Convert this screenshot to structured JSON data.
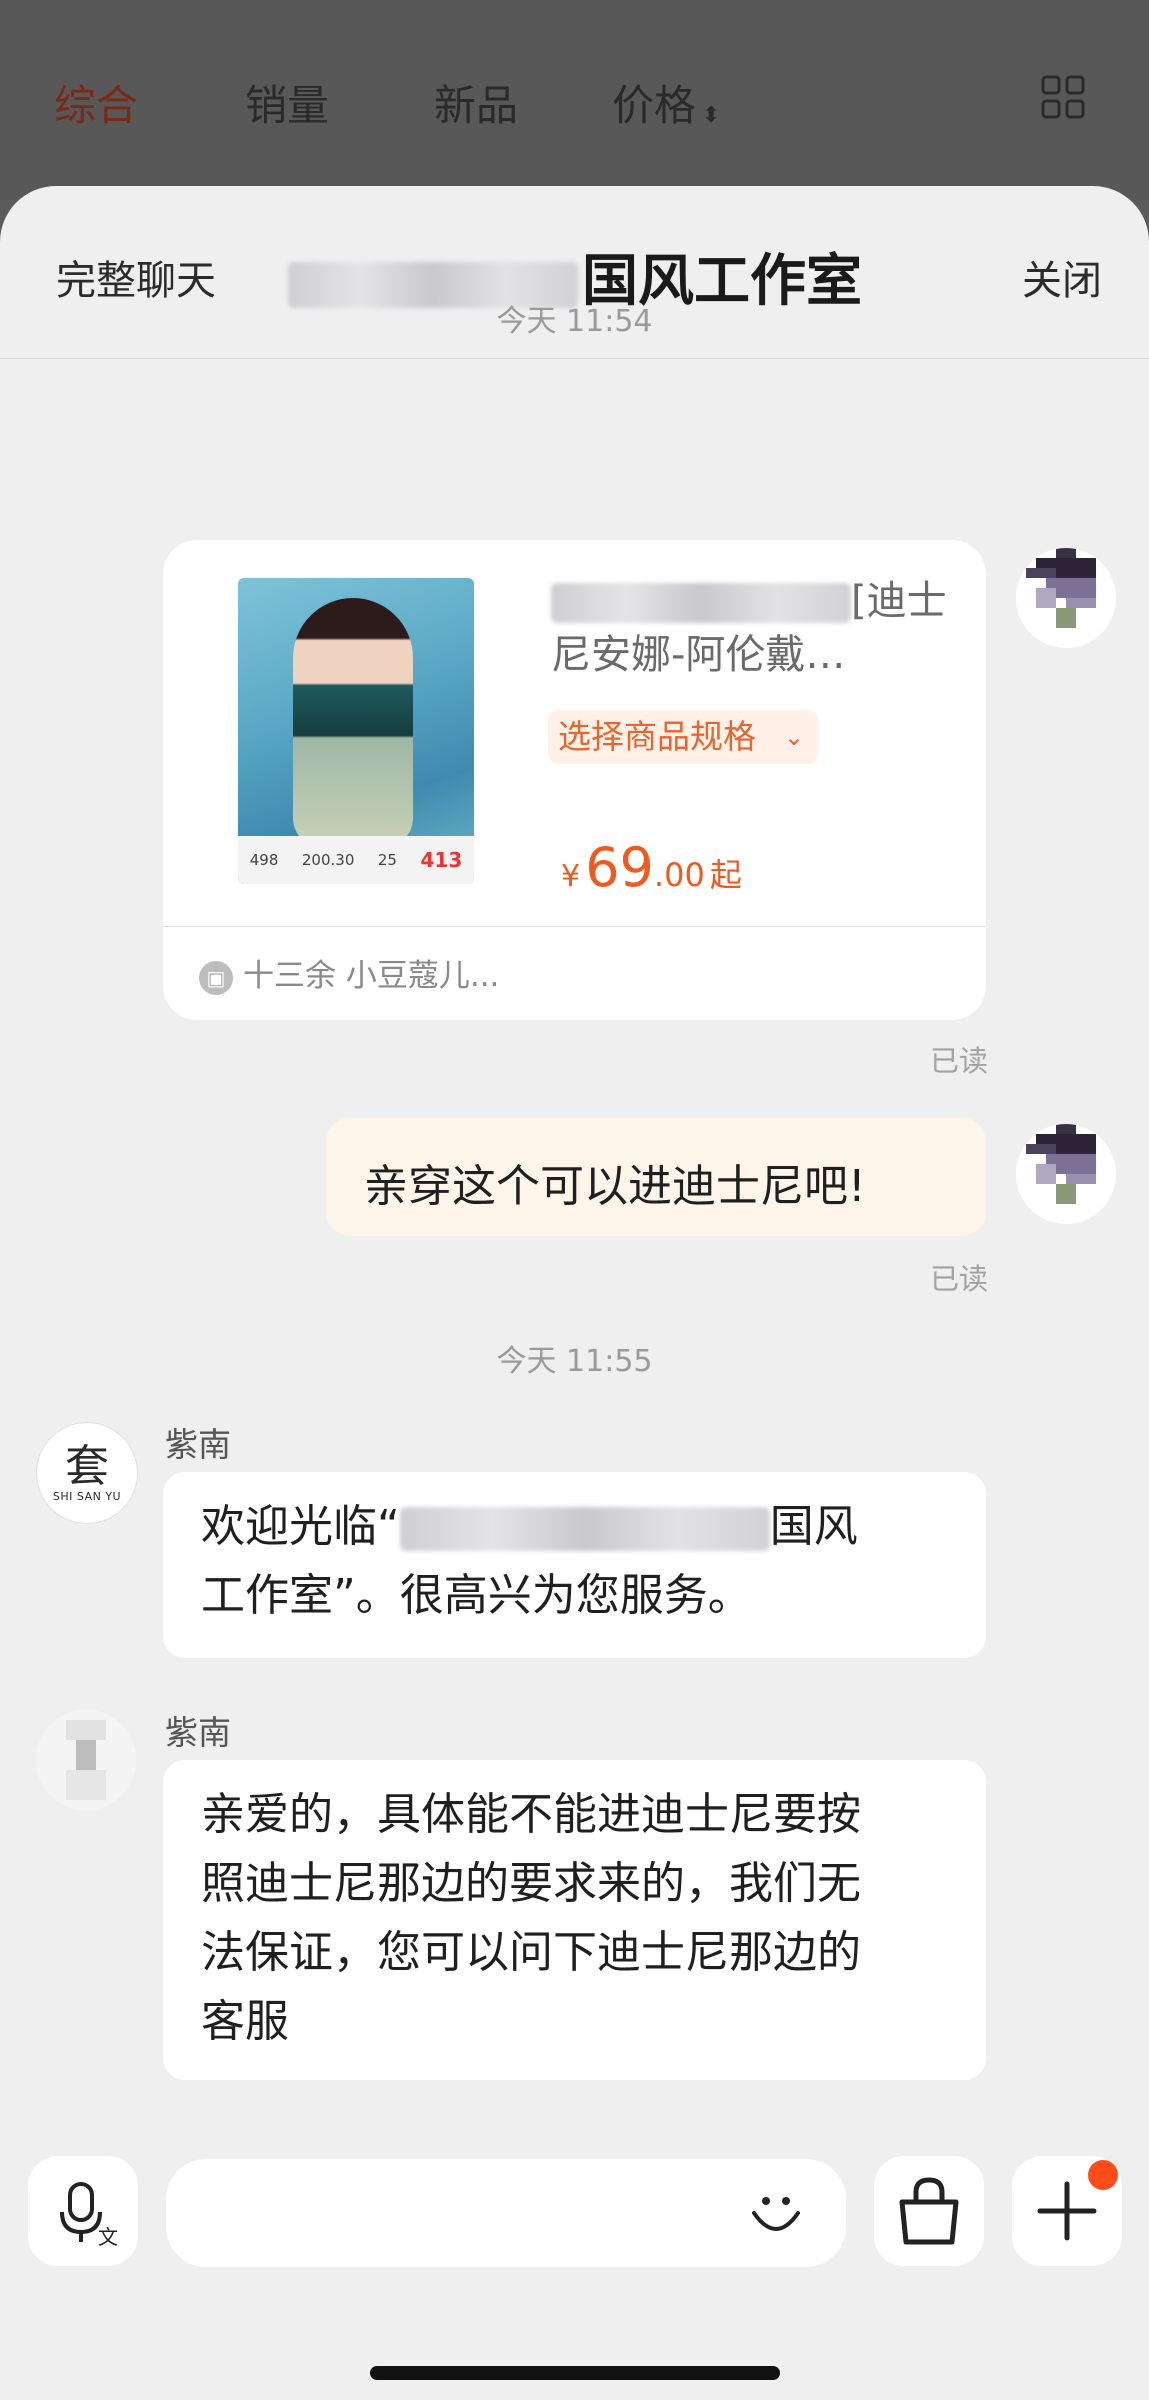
{
  "sort_bar": {
    "tabs": [
      "综合",
      "销量",
      "新品",
      "价格"
    ],
    "active": "综合"
  },
  "chat": {
    "header": {
      "left": "完整聊天",
      "title": "国风工作室",
      "right": "关闭"
    },
    "time1": "今天 11:54",
    "product": {
      "title": "[迪士尼安娜-阿伦戴…",
      "spec_label": "选择商品规格",
      "currency": "¥",
      "price_int": "69",
      "price_dec": ".00",
      "price_suffix": "起",
      "thumb_stats": [
        "498",
        "200.30",
        "25",
        "413"
      ],
      "footer": "十三余 小豆蔻儿..."
    },
    "read_label": "已读",
    "outgoing_message": "亲穿这个可以进迪士尼吧!",
    "time2": "今天 11:55",
    "agent_name": "紫南",
    "shop_avatar": {
      "glyph": "套",
      "sub": "SHI SAN YU"
    },
    "msg1_line1_a": "欢迎光临“",
    "msg1_line1_b": "国风",
    "msg1_line2": "工作室”。很高兴为您服务。",
    "msg2_lines": [
      "亲爱的，具体能不能进迪士尼要按",
      "照迪士尼那边的要求来的，我们无",
      "法保证，您可以问下迪士尼那边的",
      "客服"
    ]
  },
  "icons": [
    "voice-translate-icon",
    "emoji-icon",
    "shopping-bag-icon",
    "plus-icon",
    "grid-view-icon",
    "gift-icon",
    "chevron-down-icon"
  ],
  "colors": {
    "accent": "#ef5a1e",
    "notification_dot": "#ff4d1a",
    "outgoing_bubble": "#fdf5ea"
  }
}
